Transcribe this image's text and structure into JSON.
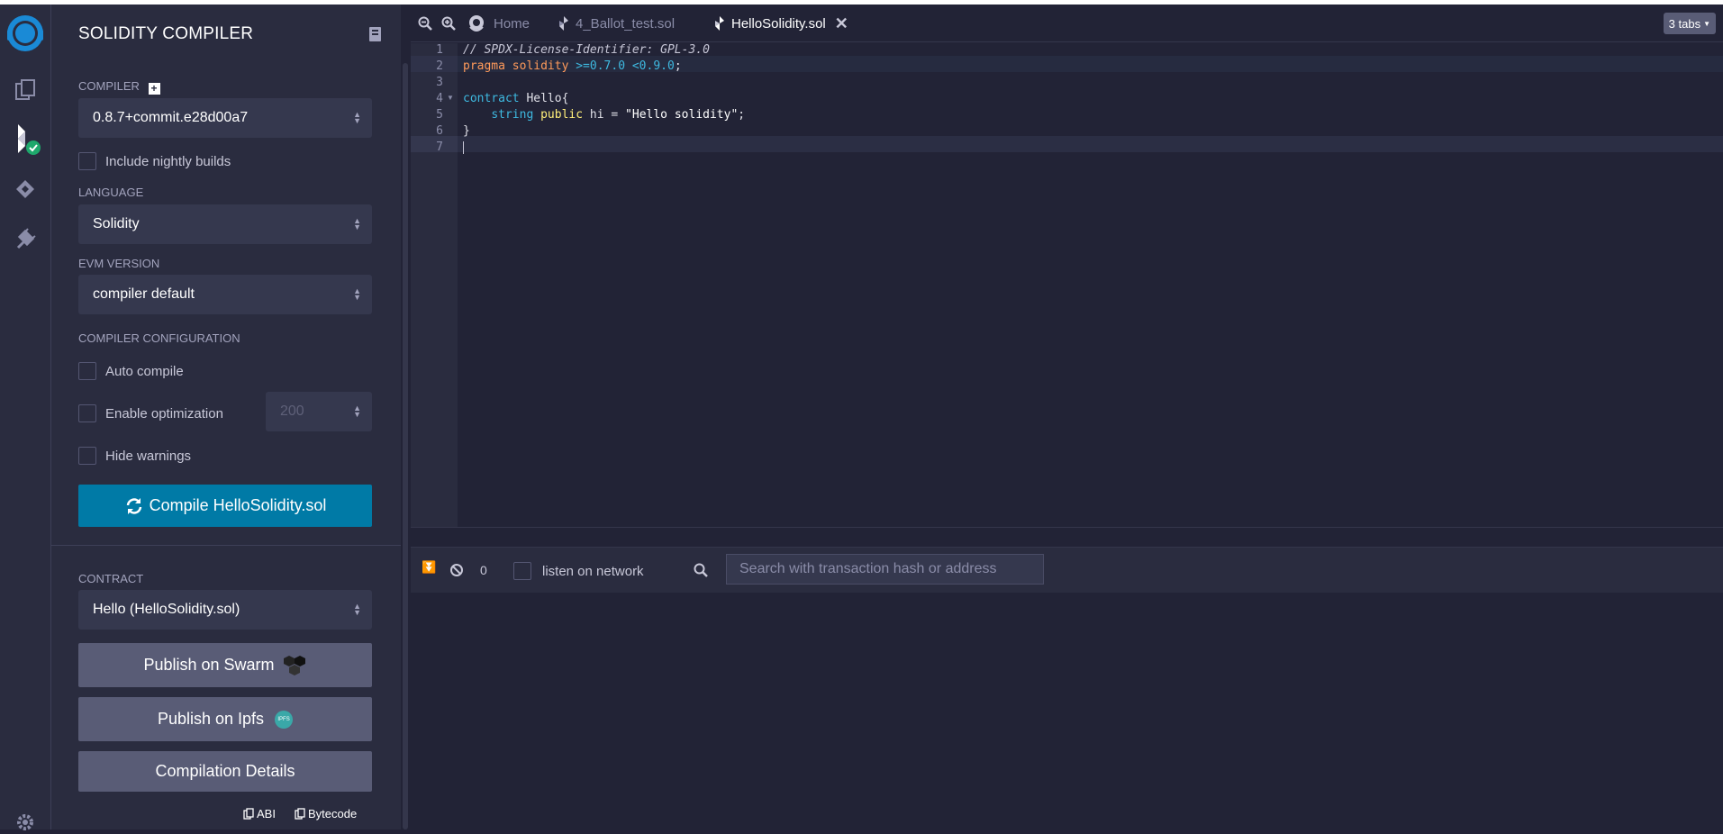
{
  "panel": {
    "title": "SOLIDITY COMPILER",
    "compiler_label": "COMPILER",
    "compiler_value": "0.8.7+commit.e28d00a7",
    "nightly_label": "Include nightly builds",
    "language_label": "LANGUAGE",
    "language_value": "Solidity",
    "evm_label": "EVM VERSION",
    "evm_value": "compiler default",
    "config_label": "COMPILER CONFIGURATION",
    "auto_compile_label": "Auto compile",
    "optimization_label": "Enable optimization",
    "optimization_runs": "200",
    "hide_warnings_label": "Hide warnings",
    "compile_button": "Compile HelloSolidity.sol",
    "contract_label": "CONTRACT",
    "contract_value": "Hello (HelloSolidity.sol)",
    "swarm_button": "Publish on Swarm",
    "ipfs_button": "Publish on Ipfs",
    "ipfs_badge": "IPFS",
    "details_button": "Compilation Details",
    "abi_link": "ABI",
    "bytecode_link": "Bytecode"
  },
  "tabs": {
    "items": [
      {
        "label": "Home",
        "icon": "remix-home-icon"
      },
      {
        "label": "4_Ballot_test.sol",
        "icon": "solidity-file-icon"
      },
      {
        "label": "HelloSolidity.sol",
        "icon": "solidity-file-icon",
        "active": true
      }
    ],
    "count_label": "3 tabs"
  },
  "editor": {
    "lines": [
      {
        "n": "1",
        "text": "// SPDX-License-Identifier: GPL-3.0"
      },
      {
        "n": "2",
        "text": "pragma solidity >=0.7.0 <0.9.0;"
      },
      {
        "n": "3",
        "text": ""
      },
      {
        "n": "4",
        "text": "contract Hello{"
      },
      {
        "n": "5",
        "text": "    string public hi = \"Hello solidity\";"
      },
      {
        "n": "6",
        "text": "}"
      },
      {
        "n": "7",
        "text": ""
      }
    ]
  },
  "terminal": {
    "pending_count": "0",
    "listen_label": "listen on network",
    "search_placeholder": "Search with transaction hash or address"
  },
  "colors": {
    "accent": "#007aa6",
    "success_badge": "#1ea86c",
    "comment": "#c6c6d6",
    "keyword": "#ff9a5a",
    "type": "#3eb9e0",
    "string": "#ffffff",
    "public": "#ffef7a"
  }
}
